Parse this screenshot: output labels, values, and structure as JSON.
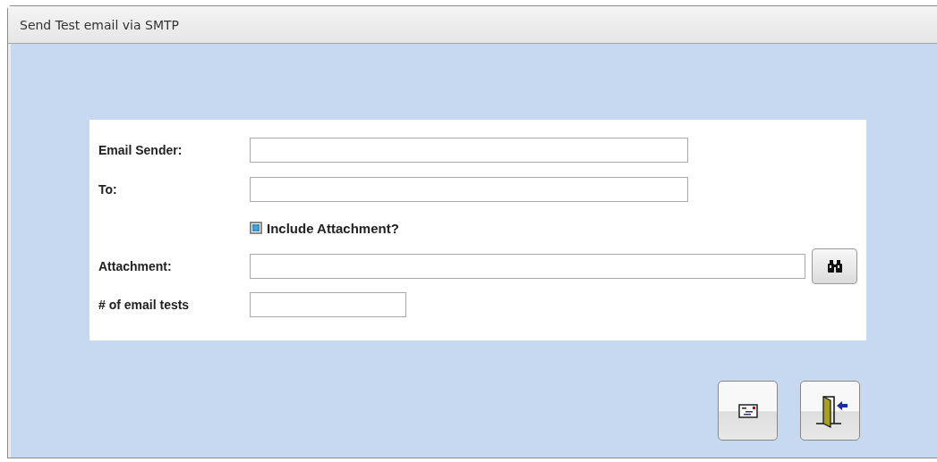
{
  "window": {
    "title": "Send Test email via SMTP"
  },
  "fields": [
    {
      "kind": "text",
      "label": "Email Sender:"
    },
    {
      "kind": "text",
      "label": "To:"
    },
    {
      "kind": "checkbox",
      "label": "Include Attachment?",
      "checked": true
    },
    {
      "kind": "browse",
      "label": "Attachment:"
    },
    {
      "kind": "count",
      "label": "# of email tests"
    }
  ],
  "buttons": [
    {
      "kind": "send"
    },
    {
      "kind": "exit"
    }
  ]
}
